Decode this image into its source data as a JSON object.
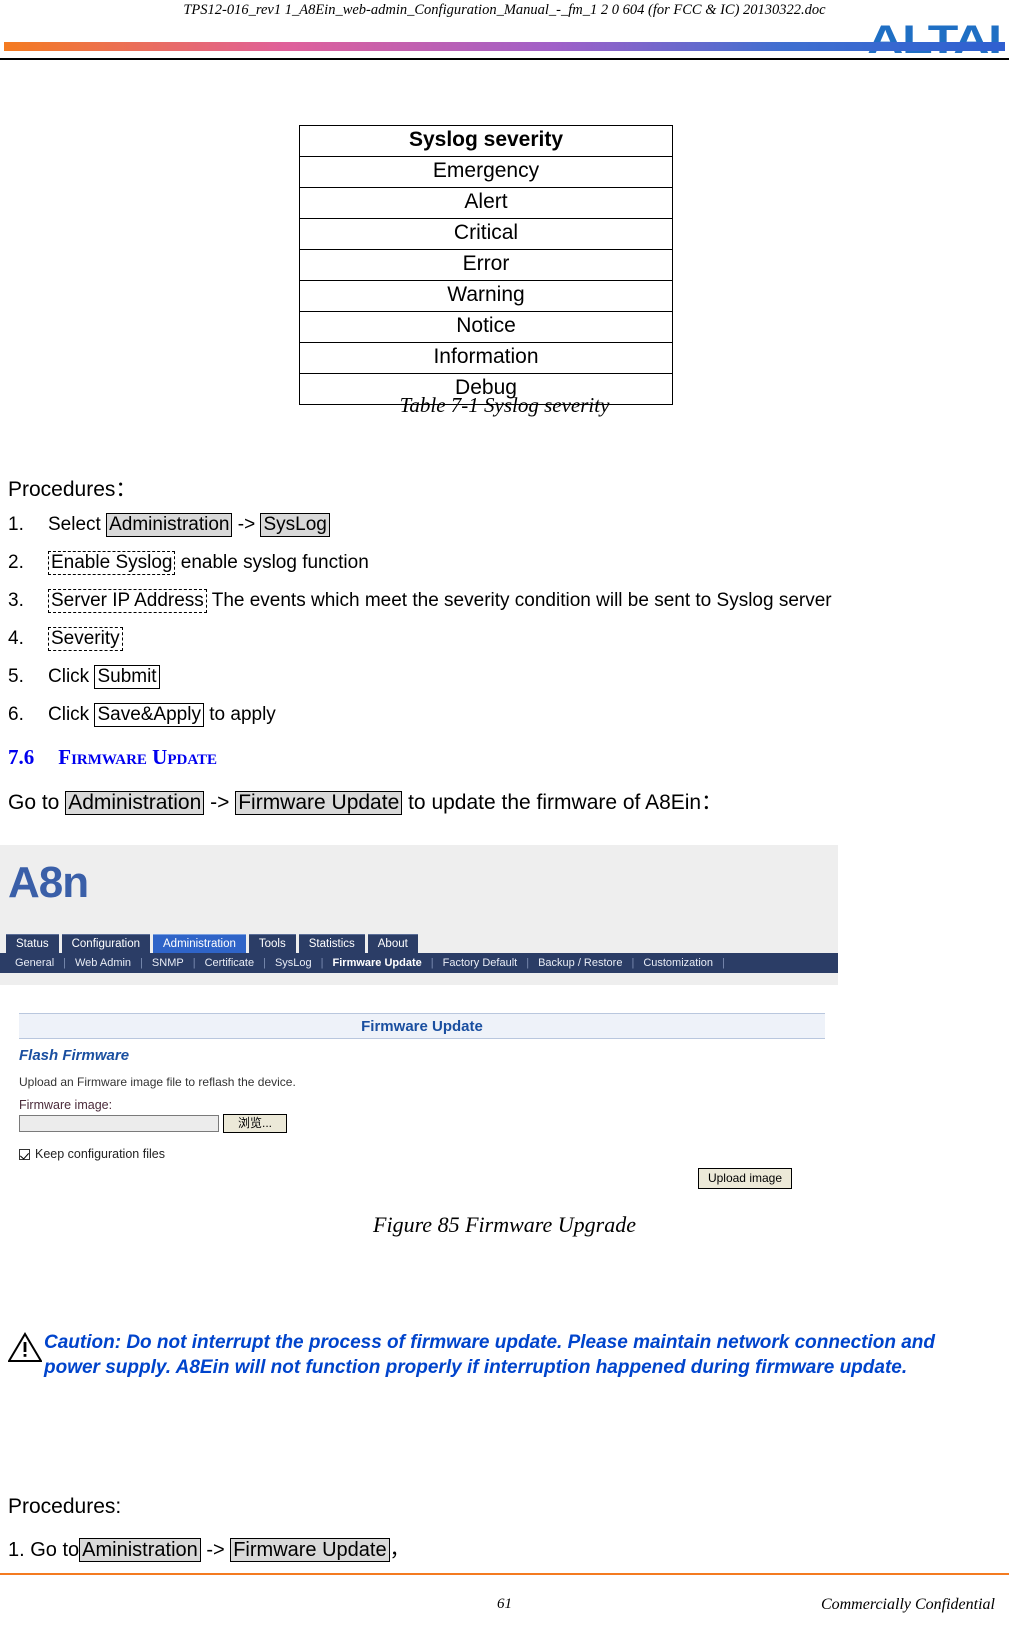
{
  "header": {
    "document_name": "TPS12-016_rev1 1_A8Ein_web-admin_Configuration_Manual_-_fm_1 2 0 604 (for FCC & IC) 20130322.doc",
    "brand_logo": "ALTAI"
  },
  "severity_table": {
    "header": "Syslog severity",
    "rows": [
      "Emergency",
      "Alert",
      "Critical",
      "Error",
      "Warning",
      "Notice",
      "Information",
      "Debug"
    ],
    "caption": "Table 7-1    Syslog severity"
  },
  "procedures": {
    "title": "Procedures：",
    "items": [
      {
        "num": "1.",
        "pre": "Select ",
        "tag1": "Administration",
        "mid": " -> ",
        "tag2": "SysLog",
        "post": ""
      },
      {
        "num": "2.",
        "tag1": "Enable Syslog",
        "post": " enable syslog function"
      },
      {
        "num": "3.",
        "tag1": "Server IP Address",
        "post": " The events which meet the severity condition will be sent to Syslog server"
      },
      {
        "num": "4.",
        "tag1": "Severity",
        "post": ""
      },
      {
        "num": "5.",
        "pre": "Click ",
        "tag1": "Submit",
        "post": ""
      },
      {
        "num": "6.",
        "pre": "Click ",
        "tag1": "Save&Apply",
        "post": " to apply"
      }
    ]
  },
  "section": {
    "number": "7.6",
    "title": "Firmware Update",
    "goto_pre": "Go to ",
    "goto_tag1": "Administration",
    "goto_mid": " -> ",
    "goto_tag2": "Firmware Update",
    "goto_post": " to update the firmware of A8Ein："
  },
  "screenshot": {
    "product_logo": "A8n",
    "main_tabs": [
      {
        "label": "Status",
        "active": false
      },
      {
        "label": "Configuration",
        "active": false
      },
      {
        "label": "Administration",
        "active": true
      },
      {
        "label": "Tools",
        "active": false
      },
      {
        "label": "Statistics",
        "active": false
      },
      {
        "label": "About",
        "active": false
      }
    ],
    "sub_tabs": [
      {
        "label": "General",
        "active": false
      },
      {
        "label": "Web Admin",
        "active": false
      },
      {
        "label": "SNMP",
        "active": false
      },
      {
        "label": "Certificate",
        "active": false
      },
      {
        "label": "SysLog",
        "active": false
      },
      {
        "label": "Firmware Update",
        "active": true
      },
      {
        "label": "Factory Default",
        "active": false
      },
      {
        "label": "Backup / Restore",
        "active": false
      },
      {
        "label": "Customization",
        "active": false
      }
    ],
    "panel": {
      "title": "Firmware Update",
      "section_heading": "Flash Firmware",
      "description": "Upload an Firmware image file to reflash the device.",
      "field_label": "Firmware image:",
      "field_value": "",
      "browse_button": "浏览...",
      "checkbox_label": "Keep configuration files",
      "checkbox_checked": true,
      "upload_button": "Upload image"
    }
  },
  "figure_caption": "Figure 85 Firmware Upgrade",
  "caution": {
    "icon": "warning-triangle-icon",
    "text": "Caution: Do not interrupt the process of firmware update. Please maintain network connection and power supply. A8Ein will not function properly if interruption happened during firmware update.",
    "color": "#0044cc"
  },
  "procedures2": {
    "title": "Procedures:",
    "line_num": "1. Go to",
    "tag1": "Aministration",
    "mid": " -> ",
    "tag2": "Firmware Update",
    "post": "，"
  },
  "footer": {
    "page_number": "61",
    "confidential": "Commercially Confidential",
    "rule_color": "#f47b20"
  }
}
